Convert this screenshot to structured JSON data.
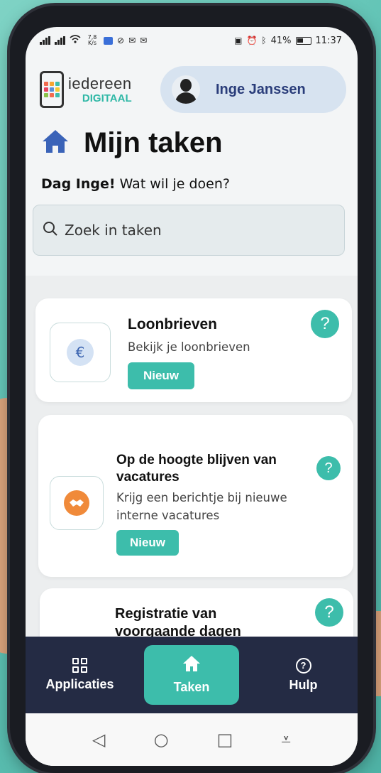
{
  "status_bar": {
    "speed": "7,8 K/s",
    "battery": "41%",
    "time": "11:37"
  },
  "logo": {
    "line1": "iedereen",
    "line2": "DIGITAAL"
  },
  "user": {
    "name": "Inge Janssen"
  },
  "page": {
    "title": "Mijn taken",
    "greeting_bold": "Dag Inge!",
    "greeting_rest": " Wat wil je doen?"
  },
  "search": {
    "placeholder": "Zoek in taken"
  },
  "tasks": [
    {
      "title": "Loonbrieven",
      "description": "Bekijk je loonbrieven",
      "badge": "Nieuw",
      "icon": "euro-icon",
      "symbol": "€"
    },
    {
      "title": "Op de hoogte blijven van vacatures",
      "description": "Krijg een berichtje bij nieuwe interne vacatures",
      "badge": "Nieuw",
      "icon": "handshake-icon"
    },
    {
      "title": "Registratie van voorgaande dagen"
    }
  ],
  "help_symbol": "?",
  "nav": {
    "items": [
      {
        "label": "Applicaties",
        "icon": "grid-icon"
      },
      {
        "label": "Taken",
        "icon": "home-icon",
        "active": true
      },
      {
        "label": "Hulp",
        "icon": "question-icon"
      }
    ]
  },
  "colors": {
    "accent": "#3dbdab",
    "nav_bg": "#242b44",
    "user_pill": "#d7e3f0",
    "title_blue": "#2a3d7a"
  }
}
